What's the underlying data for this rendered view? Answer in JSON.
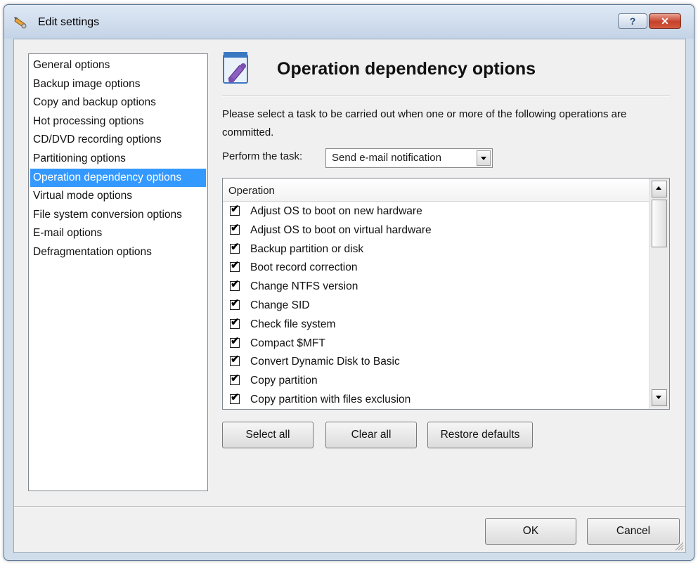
{
  "window": {
    "title": "Edit settings",
    "help_label": "?",
    "close_label": "✕"
  },
  "nav": {
    "items": [
      "General options",
      "Backup image options",
      "Copy and backup options",
      "Hot processing options",
      "CD/DVD recording options",
      "Partitioning options",
      "Operation dependency options",
      "Virtual mode options",
      "File system conversion options",
      "E-mail options",
      "Defragmentation options"
    ],
    "selected": "Operation dependency options"
  },
  "page": {
    "heading": "Operation dependency options",
    "description": "Please select a task to be carried out when one or more of the following operations are committed.",
    "task_label": "Perform the task:",
    "task_value": "Send e-mail notification"
  },
  "operations": {
    "column_header": "Operation",
    "check_glyph": "✔",
    "items": [
      {
        "label": "Adjust OS to boot on new hardware",
        "checked": true
      },
      {
        "label": "Adjust OS to boot on virtual hardware",
        "checked": true
      },
      {
        "label": "Backup partition or disk",
        "checked": true
      },
      {
        "label": "Boot record correction",
        "checked": true
      },
      {
        "label": "Change NTFS version",
        "checked": true
      },
      {
        "label": "Change SID",
        "checked": true
      },
      {
        "label": "Check file system",
        "checked": true
      },
      {
        "label": "Compact $MFT",
        "checked": true
      },
      {
        "label": "Convert Dynamic Disk to Basic",
        "checked": true
      },
      {
        "label": "Copy partition",
        "checked": true
      },
      {
        "label": "Copy partition with files exclusion",
        "checked": true
      }
    ]
  },
  "buttons": {
    "select_all": "Select all",
    "clear_all": "Clear all",
    "restore_defaults": "Restore defaults",
    "ok": "OK",
    "cancel": "Cancel"
  },
  "colors": {
    "selection": "#3399ff",
    "window_frame": "#cfdcea",
    "close_button": "#c4412a"
  },
  "icons": {
    "title": "settings-pencil-icon",
    "header": "operation-dependency-icon"
  }
}
